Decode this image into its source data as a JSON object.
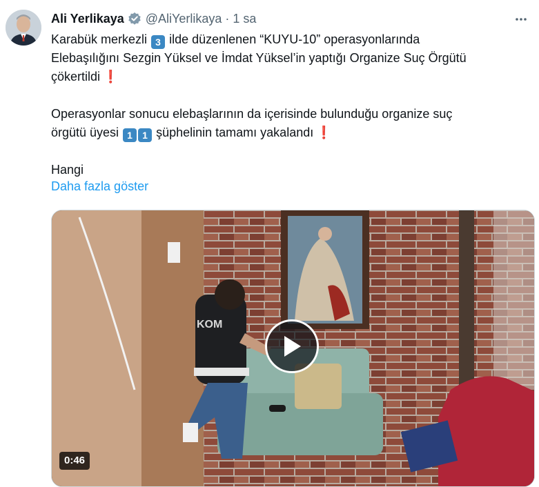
{
  "author": {
    "name": "Ali Yerlikaya",
    "handle": "@AliYerlikaya",
    "separator": "·",
    "time": "1 sa"
  },
  "icons": {
    "verified": "verified-badge-icon",
    "more": "more-options-icon",
    "play": "play-icon"
  },
  "tweet": {
    "line1_a": "Karabük merkezli",
    "line1_key": "3",
    "line1_b": "ilde düzenlenen “KUYU-10” operasyonlarında",
    "line2": "Elebaşılığını Sezgin Yüksel ve İmdat Yüksel’in yaptığı Organize Suç Örgütü",
    "line3": "çökertildi",
    "line4": "Operasyonlar sonucu elebaşlarının da içerisinde bulunduğu organize suç",
    "line5_a": "örgütü üyesi",
    "line5_key1": "1",
    "line5_key2": "1",
    "line5_b": "şüphelinin tamamı yakalandı",
    "line6": "Hangi",
    "exclamation": "❗",
    "show_more": "Daha fazla göster"
  },
  "video": {
    "duration": "0:46",
    "vest_text": "KOM"
  },
  "colors": {
    "accent": "#1d9bf0",
    "secondary_text": "#536471",
    "keycap": "#3b88c3",
    "exclamation": "#dd2e44"
  }
}
